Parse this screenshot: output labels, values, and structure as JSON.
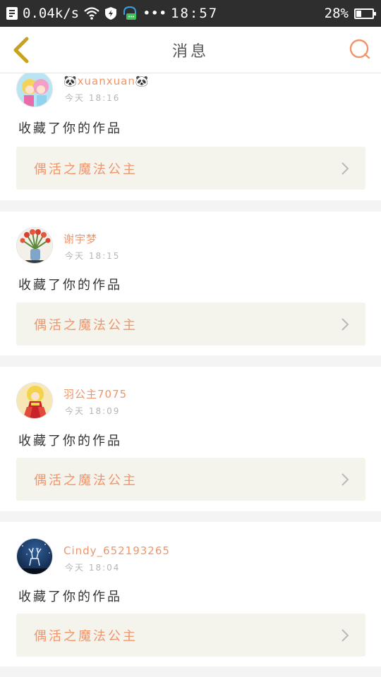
{
  "status_bar": {
    "net_speed": "0.04k/s",
    "dots": "•••",
    "time": "18:57",
    "battery_percent": "28%",
    "battery_level": 0.28
  },
  "header": {
    "title": "消息"
  },
  "colors": {
    "accent": "#f0956a",
    "back_arrow": "#c7a21e",
    "card_link_bg": "#f4f3ec"
  },
  "messages": [
    {
      "user": "🐼xuanxuan🐼",
      "time": "今天 18:16",
      "action": "收藏了你的作品",
      "work_title": "偶活之魔法公主",
      "avatar": "anime-girls-avatar"
    },
    {
      "user": "谢宇梦",
      "time": "今天 18:15",
      "action": "收藏了你的作品",
      "work_title": "偶活之魔法公主",
      "avatar": "tulips-vase-avatar"
    },
    {
      "user": "羽公主7075",
      "time": "今天 18:09",
      "action": "收藏了你的作品",
      "work_title": "偶活之魔法公主",
      "avatar": "red-dress-girl-avatar"
    },
    {
      "user": "Cindy_652193265",
      "time": "今天 18:04",
      "action": "收藏了你的作品",
      "work_title": "偶活之魔法公主",
      "avatar": "night-deer-avatar"
    }
  ]
}
